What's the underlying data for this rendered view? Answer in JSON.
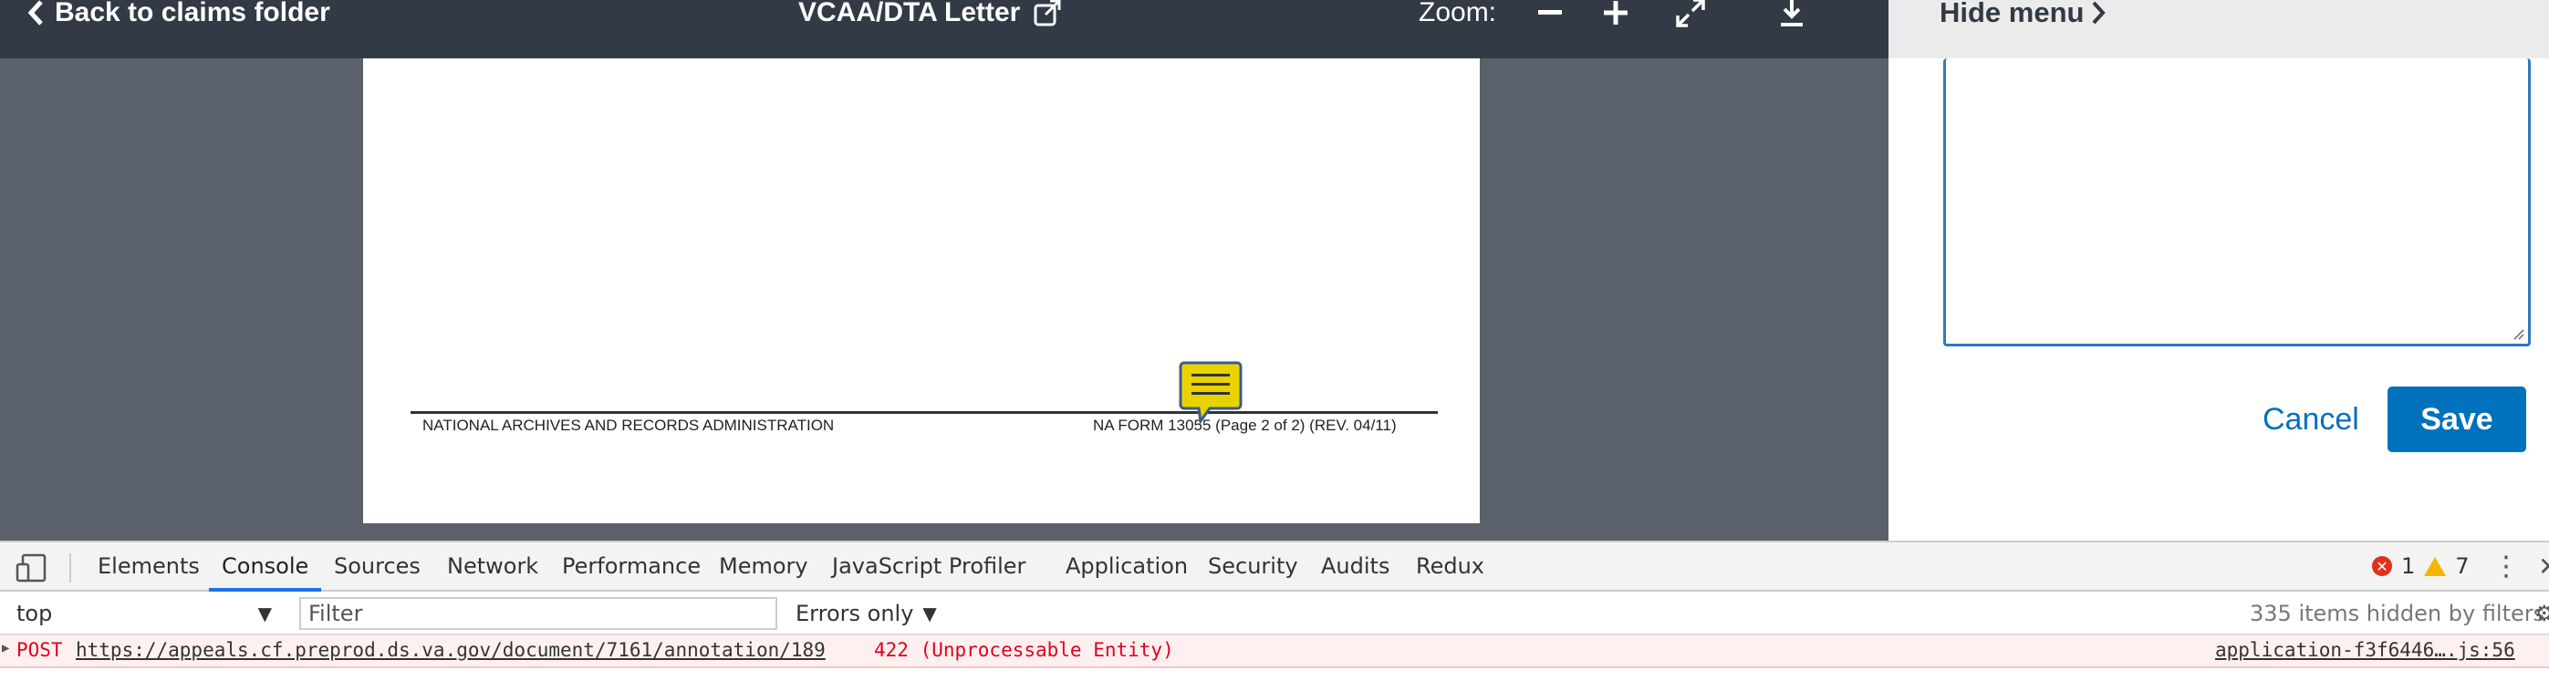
{
  "viewer": {
    "back_label": "Back to claims folder",
    "doc_title": "VCAA/DTA Letter",
    "zoom_label": "Zoom:",
    "page_footer_left": "NATIONAL ARCHIVES AND RECORDS ADMINISTRATION",
    "page_footer_right": "NA FORM 13055 (Page 2 of 2) (REV. 04/11)",
    "icons": [
      "chevron-left-icon",
      "external-link-icon",
      "zoom-out-icon",
      "zoom-in-icon",
      "fullscreen-icon",
      "download-icon",
      "comment-icon"
    ]
  },
  "sidebar": {
    "hide_menu_label": "Hide menu",
    "comment_value": "",
    "cancel_label": "Cancel",
    "save_label": "Save"
  },
  "devtools": {
    "tabs": [
      "Elements",
      "Console",
      "Sources",
      "Network",
      "Performance",
      "Memory",
      "JavaScript Profiler",
      "Application",
      "Security",
      "Audits",
      "Redux"
    ],
    "active_tab": "Console",
    "error_count": "1",
    "warning_count": "7",
    "context": "top",
    "filter_placeholder": "Filter",
    "levels_label": "Errors only",
    "hidden_items": "335 items hidden by filters",
    "message": {
      "method": "POST",
      "url": "https://appeals.cf.preprod.ds.va.gov/document/7161/annotation/189",
      "status": "422 (Unprocessable Entity)",
      "source": "application-f3f6446….js:56"
    }
  },
  "colors": {
    "topbar": "#323a45",
    "viewer_bg": "#5b616b",
    "primary": "#0071bc",
    "error": "#e0001d"
  }
}
